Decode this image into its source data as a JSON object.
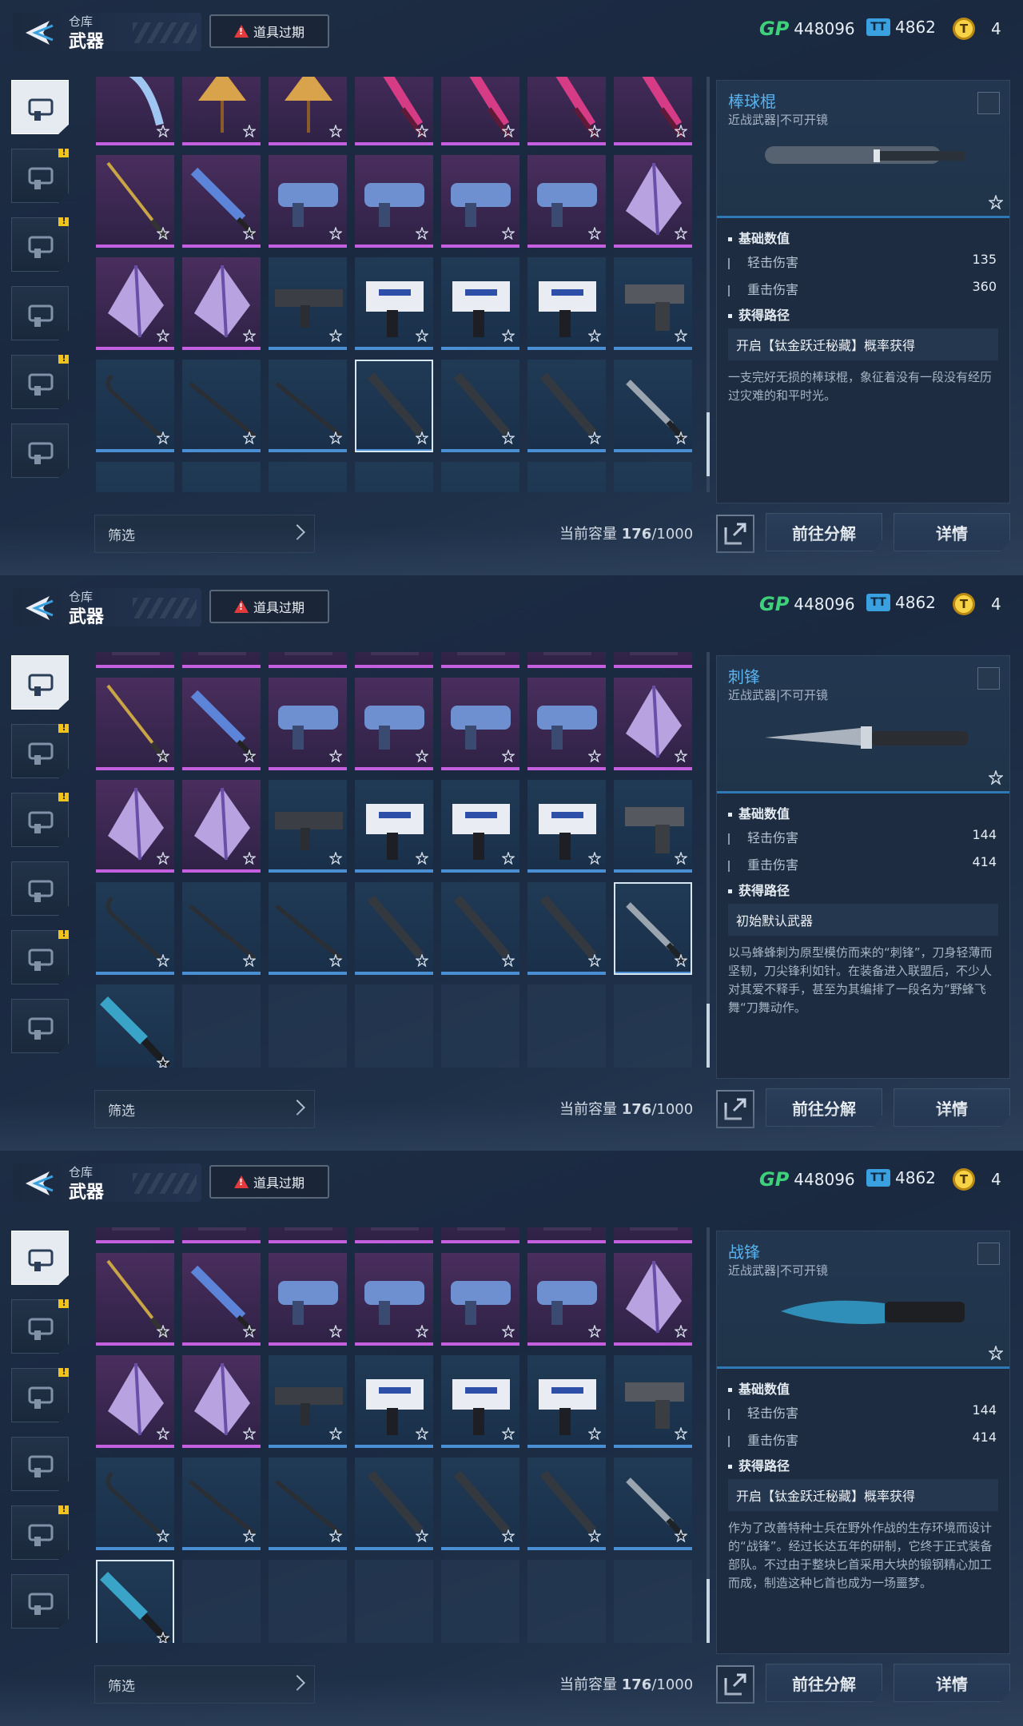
{
  "header": {
    "section": "仓库",
    "title": "武器",
    "expired_label": "道具过期"
  },
  "currency": {
    "gp_icon": "GP",
    "gp": "448096",
    "ticket": "4862",
    "coin": "4"
  },
  "sidebar": {
    "items": [
      {
        "name": "pistol",
        "active": true,
        "badge": false
      },
      {
        "name": "armor",
        "active": false,
        "badge": true
      },
      {
        "name": "grenade",
        "active": false,
        "badge": true
      },
      {
        "name": "gear",
        "active": false,
        "badge": false
      },
      {
        "name": "compass",
        "active": false,
        "badge": true
      },
      {
        "name": "star-shield",
        "active": false,
        "badge": false
      }
    ],
    "badge_text": "!"
  },
  "footer": {
    "filter_label": "筛选",
    "capacity_label": "当前容量",
    "capacity_value": "176",
    "capacity_max": "/1000",
    "decompose_label": "前往分解",
    "details_label": "详情"
  },
  "detail_common": {
    "basic_stats": "基础数值",
    "light_attack": "轻击伤害",
    "heavy_attack": "重击伤害",
    "obtain_route": "获得路径"
  },
  "panels": [
    {
      "item_name": "棒球棍",
      "item_type": "近战武器|不可开镜",
      "light": "135",
      "heavy": "360",
      "route": "开启【钛金跃迁秘藏】概率获得",
      "description": "一支完好无损的棒球棍，象征着没有一段没有经历过灾难的和平时光。"
    },
    {
      "item_name": "刺锋",
      "item_type": "近战武器|不可开镜",
      "light": "144",
      "heavy": "414",
      "route": "初始默认武器",
      "description": "以马蜂蜂刺为原型模仿而来的“刺锋”，刀身轻薄而坚韧，刀尖锋利如针。在装备进入联盟后，不少人对其爱不释手，甚至为其编排了一段名为”野蜂飞舞“刀舞动作。"
    },
    {
      "item_name": "战锋",
      "item_type": "近战武器|不可开镜",
      "light": "144",
      "heavy": "414",
      "route": "开启【钛金跃迁秘藏】概率获得",
      "description": "作为了改善特种士兵在野外作战的生存环境而设计的“战锋”。经过长达五年的研制，它终于正式装备部队。不过由于整块匕首采用大块的锻钢精心加工而成，制造这种匕首也成为一场噩梦。"
    }
  ],
  "colors": {
    "accent": "#59b3ef",
    "purple_rarity": "#c45fe0",
    "blue_rarity": "#4a8fd4",
    "gp": "#3ed07a",
    "badge": "#f2c318",
    "warning": "#e33a3a"
  }
}
